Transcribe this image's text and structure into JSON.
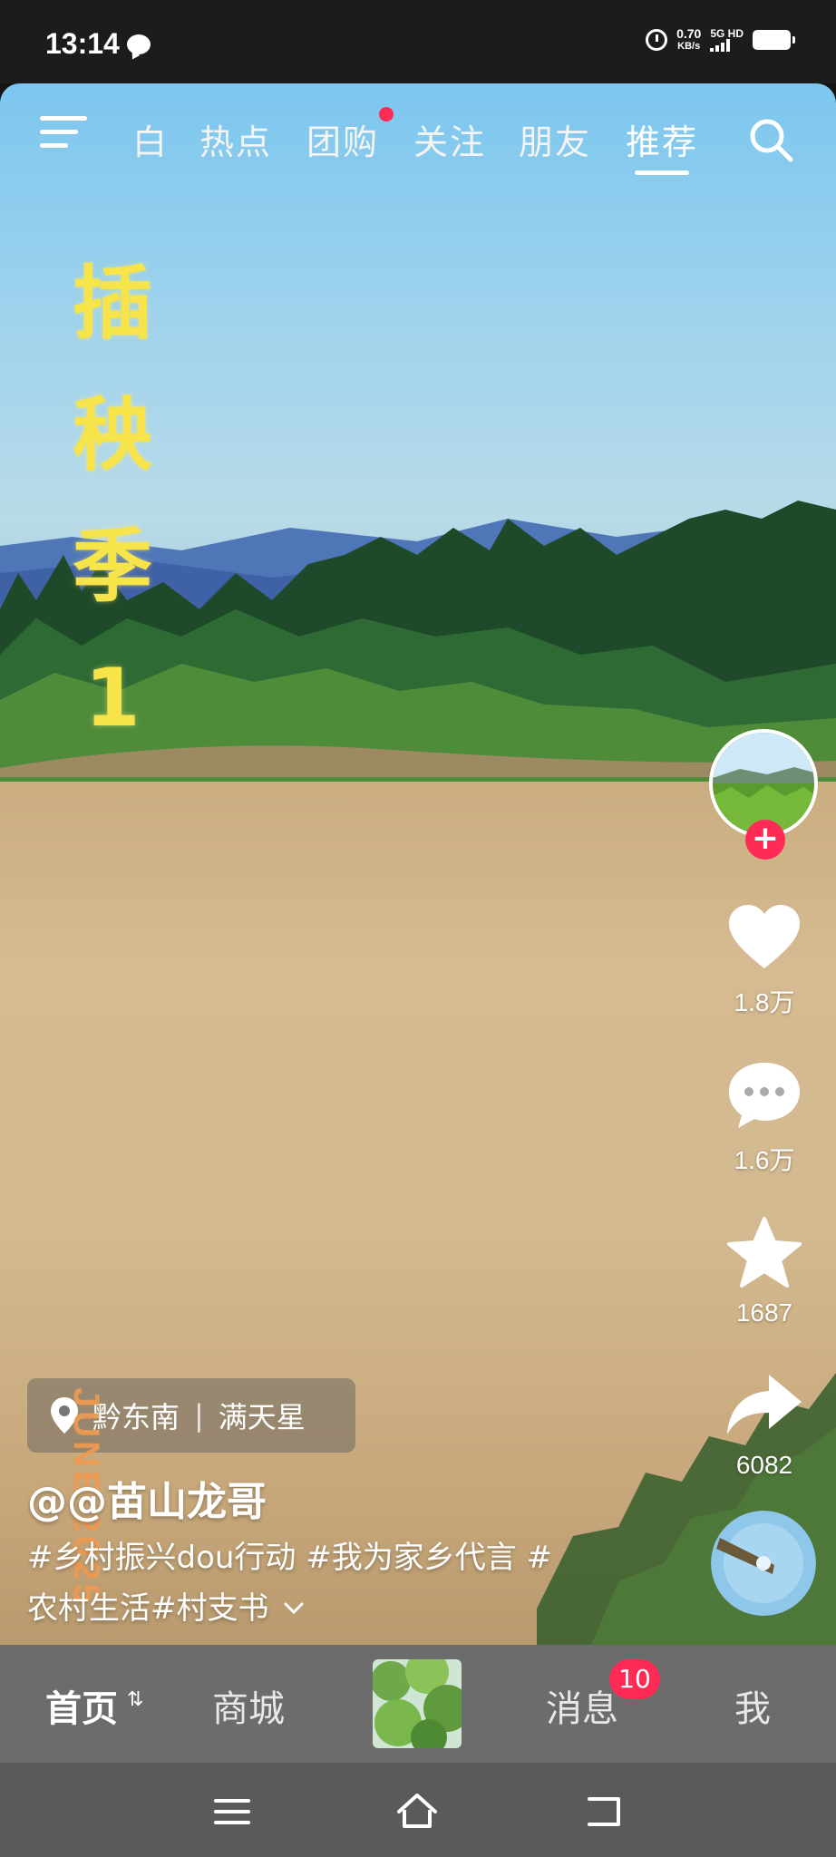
{
  "status_bar": {
    "time": "13:14",
    "net_speed_value": "0.70",
    "net_speed_unit": "KB/s",
    "network_label": "5G HD",
    "icons": [
      "chat-icon",
      "alarm-icon",
      "signal-icon",
      "battery-icon"
    ]
  },
  "top_nav": {
    "tabs": [
      {
        "label": "白",
        "active": false
      },
      {
        "label": "热点",
        "active": false
      },
      {
        "label": "团购",
        "active": false,
        "dot": true
      },
      {
        "label": "关注",
        "active": false
      },
      {
        "label": "朋友",
        "active": false
      },
      {
        "label": "推荐",
        "active": true
      }
    ],
    "icons": [
      "menu-icon",
      "search-icon"
    ]
  },
  "video": {
    "overlay_title": [
      "插",
      "秧",
      "季",
      "1"
    ],
    "overlay_date": "JUNE 2025",
    "location": {
      "place": "黔东南",
      "detail": "满天星"
    },
    "author": "@@苗山龙哥",
    "desc_line1": "#乡村振兴dou行动 #我为家乡代言 #",
    "desc_line2": "农村生活#村支书"
  },
  "actions": {
    "likes": "1.8万",
    "comments": "1.6万",
    "favorites": "1687",
    "shares": "6082"
  },
  "bottom_nav": {
    "home": "首页",
    "mall": "商城",
    "messages": "消息",
    "messages_badge": "10",
    "me": "我"
  },
  "colors": {
    "accent": "#fe2c55",
    "title_yellow": "#f7e34a",
    "bottom_nav_bg": "#6c6c6c"
  }
}
